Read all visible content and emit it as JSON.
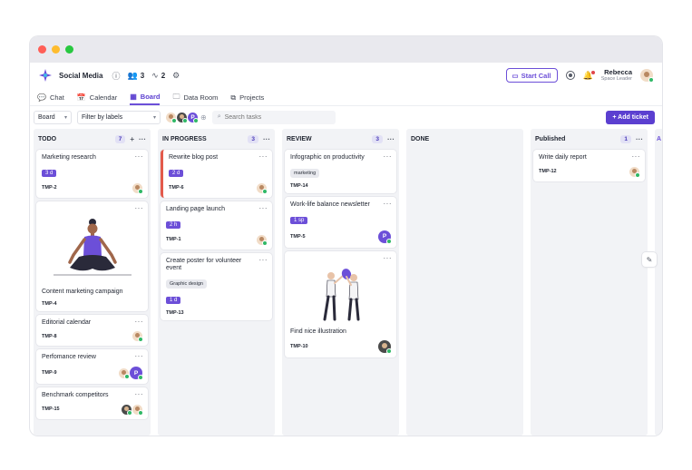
{
  "workspace": {
    "name": "Social Media",
    "members_count": "3",
    "activity_count": "2"
  },
  "header": {
    "start_call_label": "Start Call",
    "user_name": "Rebecca",
    "user_role": "Space Leader"
  },
  "tabs": [
    {
      "label": "Chat",
      "icon": "chat-icon"
    },
    {
      "label": "Calendar",
      "icon": "calendar-icon"
    },
    {
      "label": "Board",
      "icon": "board-icon",
      "active": true
    },
    {
      "label": "Data Room",
      "icon": "folder-icon"
    },
    {
      "label": "Projects",
      "icon": "projects-icon"
    }
  ],
  "toolbar": {
    "view_select": "Board",
    "filter_select": "Filter by labels",
    "member_letter": "P",
    "search_placeholder": "Search tasks",
    "add_ticket_label": "+ Add ticket"
  },
  "columns": [
    {
      "title": "TODO",
      "count": "7",
      "cards": [
        {
          "title": "Marketing research",
          "estimate": "3 d",
          "id": "TMP-2"
        },
        {
          "title": "Content marketing campaign",
          "id": "TMP-4",
          "illustration": "yoga-illustration"
        },
        {
          "title": "Editorial calendar",
          "id": "TMP-8"
        },
        {
          "title": "Perfomance review",
          "id": "TMP-9",
          "assignee_letter": "P"
        },
        {
          "title": "Benchmark competitors",
          "id": "TMP-15"
        }
      ]
    },
    {
      "title": "IN PROGRESS",
      "count": "3",
      "cards": [
        {
          "title": "Rewrite blog post",
          "estimate": "2 d",
          "id": "TMP-6"
        },
        {
          "title": "Landing page launch",
          "estimate": "2 h",
          "id": "TMP-1"
        },
        {
          "title": "Create poster for volunteer event",
          "label": "Graphic design",
          "estimate": "1 d",
          "id": "TMP-13"
        }
      ]
    },
    {
      "title": "REVIEW",
      "count": "3",
      "cards": [
        {
          "title": "Infographic on productivity",
          "label": "marketing",
          "id": "TMP-14"
        },
        {
          "title": "Work-life balance newsletter",
          "estimate": "1 sp",
          "id": "TMP-5",
          "assignee_letter": "P"
        },
        {
          "title": "Find nice illustration",
          "id": "TMP-10",
          "illustration": "two-people-illustration"
        }
      ]
    },
    {
      "title": "DONE",
      "cards": []
    },
    {
      "title": "Published",
      "count": "1",
      "cards": [
        {
          "title": "Write daily report",
          "id": "TMP-12"
        }
      ]
    },
    {
      "title": "A"
    }
  ],
  "colors": {
    "accent": "#6c4fd8",
    "in_progress_stripe": "#e35a4b",
    "online": "#2fb866"
  }
}
